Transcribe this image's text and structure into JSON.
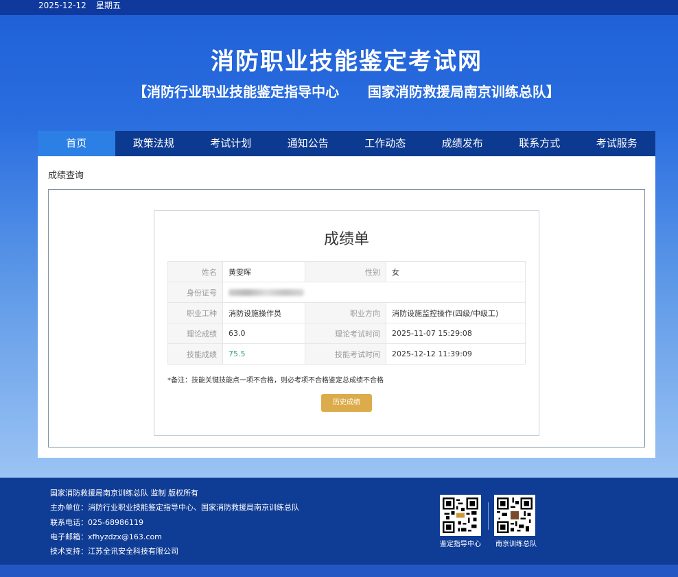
{
  "top_bar": {
    "date": "2025-12-12",
    "weekday": "星期五"
  },
  "header": {
    "title": "消防职业技能鉴定考试网",
    "subtitle": "【消防行业职业技能鉴定指导中心      国家消防救援局南京训练总队】"
  },
  "nav": {
    "items": [
      {
        "label": "首页"
      },
      {
        "label": "政策法规"
      },
      {
        "label": "考试计划"
      },
      {
        "label": "通知公告"
      },
      {
        "label": "工作动态"
      },
      {
        "label": "成绩发布"
      },
      {
        "label": "联系方式"
      },
      {
        "label": "考试服务"
      }
    ],
    "active_index": 0
  },
  "breadcrumb": "成绩查询",
  "report": {
    "title": "成绩单",
    "rows": [
      {
        "label1": "姓名",
        "value1": "黄雯晖",
        "label2": "性别",
        "value2": "女"
      },
      {
        "label1": "身份证号",
        "value1_obscured": true
      },
      {
        "label1": "职业工种",
        "value1": "消防设施操作员",
        "label2": "职业方向",
        "value2": "消防设施监控操作(四级/中级工)"
      },
      {
        "label1": "理论成绩",
        "value1": "63.0",
        "label2": "理论考试时间",
        "value2": "2025-11-07 15:29:08"
      },
      {
        "label1": "技能成绩",
        "value1": "75.5",
        "label2": "技能考试时间",
        "value2": "2025-12-12 11:39:09"
      }
    ],
    "note": "*备注：技能关键技能点一项不合格，则必考项不合格鉴定总成绩不合格",
    "history_button": "历史成绩"
  },
  "footer": {
    "copyright": "国家消防救援局南京训练总队 监制 版权所有",
    "organizer": "主办单位：消防行业职业技能鉴定指导中心、国家消防救援局南京训练总队",
    "phone": "联系电话：025-68986119",
    "email": "电子邮箱：xfhyzdzx@163.com",
    "tech_support": "技术支持：江苏全讯安全科技有限公司",
    "qr1_caption": "鉴定指导中心",
    "qr2_caption": "南京训练总队"
  },
  "colors": {
    "nav_bg": "#0d3a91",
    "nav_active": "#2b7fe5",
    "footer_bg": "#0f3c95",
    "button": "#dcab4b",
    "skill_score": "#3a9e8a"
  }
}
